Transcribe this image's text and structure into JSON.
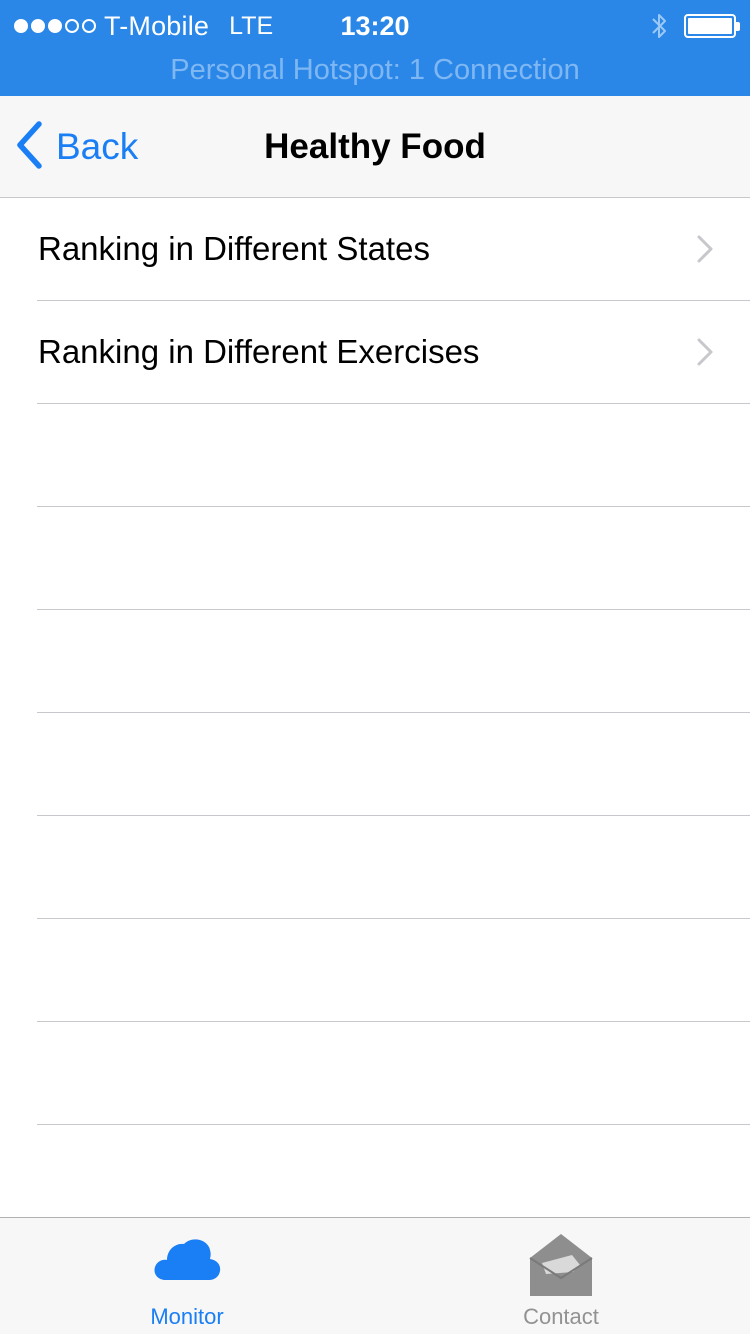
{
  "status_bar": {
    "carrier": "T-Mobile",
    "network": "LTE",
    "time": "13:20",
    "signal_bars_filled": 3,
    "signal_bars_total": 5,
    "battery_level": 1.0,
    "hotspot_banner": "Personal Hotspot: 1 Connection"
  },
  "nav_bar": {
    "back_label": "Back",
    "title": "Healthy Food"
  },
  "table": {
    "rows": [
      {
        "label": "Ranking in Different States"
      },
      {
        "label": "Ranking in Different Exercises"
      }
    ]
  },
  "tab_bar": {
    "tabs": [
      {
        "label": "Monitor",
        "icon": "cloud-icon",
        "selected": true
      },
      {
        "label": "Contact",
        "icon": "envelope-icon",
        "selected": false
      }
    ]
  },
  "colors": {
    "status_bar_bg": "#2a87e8",
    "accent": "#1a7ef5",
    "separator": "#c8c7cc",
    "inactive_tab": "#929292"
  }
}
